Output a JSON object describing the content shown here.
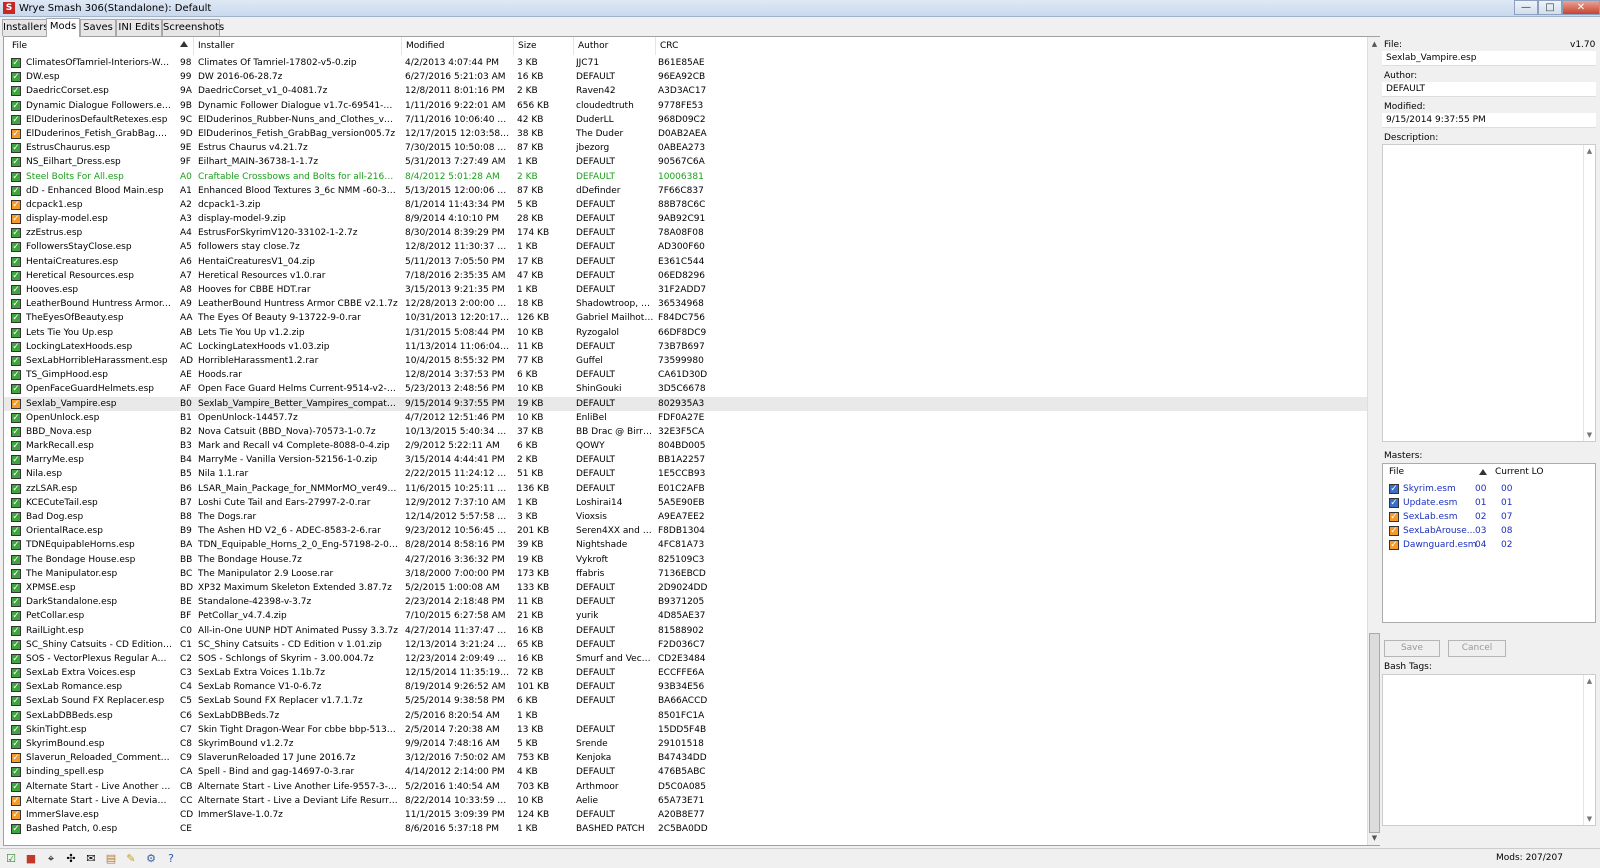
{
  "window": {
    "title": "Wrye Smash 306(Standalone): Default",
    "app_icon": "S",
    "controls": {
      "minimize": "—",
      "maximize": "□",
      "close": "✕"
    }
  },
  "tabs": [
    "Installers",
    "Mods",
    "Saves",
    "INI Edits",
    "Screenshots"
  ],
  "mods_table": {
    "columns": {
      "file": "File",
      "installer": "Installer",
      "modified": "Modified",
      "size": "Size",
      "author": "Author",
      "crc": "CRC"
    },
    "rows": [
      {
        "file": "ClimatesOfTamriel-Interiors-Warm...",
        "lo": "98",
        "installer": "Climates Of Tamriel-17802-v5-0.zip",
        "modified": "4/2/2013 4:07:44 PM",
        "size": "3 KB",
        "author": "JJC71",
        "crc": "B61E85AE",
        "check": "green"
      },
      {
        "file": "DW.esp",
        "lo": "99",
        "installer": "DW 2016-06-28.7z",
        "modified": "6/27/2016 5:21:03 AM",
        "size": "16 KB",
        "author": "DEFAULT",
        "crc": "96EA92CB",
        "check": "green"
      },
      {
        "file": "DaedricCorset.esp",
        "lo": "9A",
        "installer": "DaedricCorset_v1_0-4081.7z",
        "modified": "12/8/2011 8:01:16 PM",
        "size": "2 KB",
        "author": "Raven42",
        "crc": "A3D3AC17",
        "check": "green"
      },
      {
        "file": "Dynamic Dialogue Followers.esp",
        "lo": "9B",
        "installer": "Dynamic Follower Dialogue v1.7c-69541-1-7c.7z",
        "modified": "1/11/2016 9:22:01 AM",
        "size": "656 KB",
        "author": "cloudedtruth",
        "crc": "9778FE53",
        "check": "green"
      },
      {
        "file": "ElDuderinosDefaultRetexes.esp",
        "lo": "9C",
        "installer": "ElDuderinos_Rubber-Nuns_and_Clothes_versio...",
        "modified": "7/11/2016 10:06:40 AM",
        "size": "42 KB",
        "author": "DuderLL",
        "crc": "968D09C2",
        "check": "green"
      },
      {
        "file": "ElDuderinos_Fetish_GrabBag.esp",
        "lo": "9D",
        "installer": "ElDuderinos_Fetish_GrabBag_version005.7z",
        "modified": "12/17/2015 12:03:58 PM",
        "size": "38 KB",
        "author": "The Duder",
        "crc": "D0AB2AEA",
        "check": "orange"
      },
      {
        "file": "EstrusChaurus.esp",
        "lo": "9E",
        "installer": "Estrus Chaurus v4.21.7z",
        "modified": "7/30/2015 10:50:08 AM",
        "size": "87 KB",
        "author": "jbezorg",
        "crc": "0ABEA273",
        "check": "green"
      },
      {
        "file": "NS_Eilhart_Dress.esp",
        "lo": "9F",
        "installer": "Eilhart_MAIN-36738-1-1.7z",
        "modified": "5/31/2013 7:27:49 AM",
        "size": "1 KB",
        "author": "DEFAULT",
        "crc": "90567C6A",
        "check": "green"
      },
      {
        "file": "Steel Bolts For All.esp",
        "lo": "A0",
        "installer": "Craftable  Crossbows and Bolts for all-21659-1-...",
        "modified": "8/4/2012 5:01:28 AM",
        "size": "2 KB",
        "author": "DEFAULT",
        "crc": "10006381",
        "check": "green",
        "green": true
      },
      {
        "file": "dD - Enhanced Blood Main.esp",
        "lo": "A1",
        "installer": "Enhanced Blood Textures 3_6c NMM -60-3-6c.7z",
        "modified": "5/13/2015 12:00:06 AM",
        "size": "87 KB",
        "author": "dDefinder",
        "crc": "7F66C837",
        "check": "green"
      },
      {
        "file": "dcpack1.esp",
        "lo": "A2",
        "installer": "dcpack1-3.zip",
        "modified": "8/1/2014 11:43:34 PM",
        "size": "5 KB",
        "author": "DEFAULT",
        "crc": "88B78C6C",
        "check": "orange"
      },
      {
        "file": "display-model.esp",
        "lo": "A3",
        "installer": "display-model-9.zip",
        "modified": "8/9/2014 4:10:10 PM",
        "size": "28 KB",
        "author": "DEFAULT",
        "crc": "9AB92C91",
        "check": "orange"
      },
      {
        "file": "zzEstrus.esp",
        "lo": "A4",
        "installer": "EstrusForSkyrimV120-33102-1-2.7z",
        "modified": "8/30/2014 8:39:29 PM",
        "size": "174 KB",
        "author": "DEFAULT",
        "crc": "78A08F08",
        "check": "green"
      },
      {
        "file": "FollowersStayClose.esp",
        "lo": "A5",
        "installer": "followers stay close.7z",
        "modified": "12/8/2012 11:30:37 PM",
        "size": "1 KB",
        "author": "DEFAULT",
        "crc": "AD300F60",
        "check": "green"
      },
      {
        "file": "HentaiCreatures.esp",
        "lo": "A6",
        "installer": "HentaiCreaturesV1_04.zip",
        "modified": "5/11/2013 7:05:50 PM",
        "size": "17 KB",
        "author": "DEFAULT",
        "crc": "E361C544",
        "check": "green"
      },
      {
        "file": "Heretical Resources.esp",
        "lo": "A7",
        "installer": "Heretical Resources v1.0.rar",
        "modified": "7/18/2016 2:35:35 AM",
        "size": "47 KB",
        "author": "DEFAULT",
        "crc": "06ED8296",
        "check": "green"
      },
      {
        "file": "Hooves.esp",
        "lo": "A8",
        "installer": "Hooves for CBBE HDT.rar",
        "modified": "3/15/2013 9:21:35 PM",
        "size": "1 KB",
        "author": "DEFAULT",
        "crc": "31F2ADD7",
        "check": "green"
      },
      {
        "file": "LeatherBound Huntress Armor.esp",
        "lo": "A9",
        "installer": "LeatherBound Huntress Armor CBBE v2.1.7z",
        "modified": "12/28/2013 2:00:00 PM",
        "size": "18 KB",
        "author": "Shadowtroop, B...",
        "crc": "36534968",
        "check": "green"
      },
      {
        "file": "TheEyesOfBeauty.esp",
        "lo": "AA",
        "installer": "The Eyes Of Beauty 9-13722-9-0.rar",
        "modified": "10/31/2013 12:20:17 AM",
        "size": "126 KB",
        "author": "Gabriel Mailhot a...",
        "crc": "F84DC756",
        "check": "green"
      },
      {
        "file": "Lets Tie You Up.esp",
        "lo": "AB",
        "installer": "Lets Tie You Up v1.2.zip",
        "modified": "1/31/2015 5:08:44 PM",
        "size": "10 KB",
        "author": "Ryzogalol",
        "crc": "66DF8DC9",
        "check": "green"
      },
      {
        "file": "LockingLatexHoods.esp",
        "lo": "AC",
        "installer": "LockingLatexHoods v1.03.zip",
        "modified": "11/13/2014 11:06:04 PM",
        "size": "11 KB",
        "author": "DEFAULT",
        "crc": "73B7B697",
        "check": "green"
      },
      {
        "file": "SexLabHorribleHarassment.esp",
        "lo": "AD",
        "installer": "HorribleHarassment1.2.rar",
        "modified": "10/4/2015 8:55:32 PM",
        "size": "77 KB",
        "author": "Guffel",
        "crc": "73599980",
        "check": "green"
      },
      {
        "file": "TS_GimpHood.esp",
        "lo": "AE",
        "installer": "Hoods.rar",
        "modified": "12/8/2014 3:37:53 PM",
        "size": "6 KB",
        "author": "DEFAULT",
        "crc": "CA61D30D",
        "check": "green"
      },
      {
        "file": "OpenFaceGuardHelmets.esp",
        "lo": "AF",
        "installer": "Open Face Guard Helms Current-9514-v2-0.zip",
        "modified": "5/23/2013 2:48:56 PM",
        "size": "10 KB",
        "author": "ShinGouki",
        "crc": "3D5C6678",
        "check": "green"
      },
      {
        "file": "Sexlab_Vampire.esp",
        "lo": "B0",
        "installer": "Sexlab_Vampire_Better_Vampires_compatible_1...",
        "modified": "9/15/2014 9:37:55 PM",
        "size": "19 KB",
        "author": "DEFAULT",
        "crc": "802935A3",
        "check": "orange",
        "selected": true
      },
      {
        "file": "OpenUnlock.esp",
        "lo": "B1",
        "installer": "OpenUnlock-14457.7z",
        "modified": "4/7/2012 12:51:46 PM",
        "size": "10 KB",
        "author": "EnliBel",
        "crc": "FDF0A27E",
        "check": "green"
      },
      {
        "file": "BBD_Nova.esp",
        "lo": "B2",
        "installer": "Nova Catsuit (BBD_Nova)-70573-1-0.7z",
        "modified": "10/13/2015 5:40:34 AM",
        "size": "37 KB",
        "author": "BB Drac @ BirraB...",
        "crc": "32E3F5CA",
        "check": "green"
      },
      {
        "file": "MarkRecall.esp",
        "lo": "B3",
        "installer": "Mark and Recall v4 Complete-8088-0-4.zip",
        "modified": "2/9/2012 5:22:11 AM",
        "size": "6 KB",
        "author": "QOWY",
        "crc": "804BD005",
        "check": "green"
      },
      {
        "file": "MarryMe.esp",
        "lo": "B4",
        "installer": "MarryMe - Vanilla Version-52156-1-0.zip",
        "modified": "3/15/2014 4:44:41 PM",
        "size": "2 KB",
        "author": "DEFAULT",
        "crc": "BB1A2257",
        "check": "green"
      },
      {
        "file": "Nila.esp",
        "lo": "B5",
        "installer": "Nila 1.1.rar",
        "modified": "2/22/2015 11:24:12 PM",
        "size": "51 KB",
        "author": "DEFAULT",
        "crc": "1E5CCB93",
        "check": "green"
      },
      {
        "file": "zzLSAR.esp",
        "lo": "B6",
        "installer": "LSAR_Main_Package_for_NMMorMO_ver499-55...",
        "modified": "11/6/2015 10:25:11 PM",
        "size": "136 KB",
        "author": "DEFAULT",
        "crc": "E01C2AFB",
        "check": "green"
      },
      {
        "file": "KCECuteTail.esp",
        "lo": "B7",
        "installer": "Loshi Cute Tail and Ears-27997-2-0.rar",
        "modified": "12/9/2012 7:37:10 AM",
        "size": "1 KB",
        "author": "Loshirai14",
        "crc": "5A5E90EB",
        "check": "green"
      },
      {
        "file": "Bad Dog.esp",
        "lo": "B8",
        "installer": "The Dogs.rar",
        "modified": "12/14/2012 5:57:58 PM",
        "size": "3 KB",
        "author": "Vioxsis",
        "crc": "A9EA7EE2",
        "check": "green"
      },
      {
        "file": "OrientalRace.esp",
        "lo": "B9",
        "installer": "The Ashen HD V2_6 - ADEC-8583-2-6.rar",
        "modified": "9/23/2012 10:56:45 PM",
        "size": "201 KB",
        "author": "Seren4XX and R...",
        "crc": "F8DB1304",
        "check": "green"
      },
      {
        "file": "TDNEquipableHorns.esp",
        "lo": "BA",
        "installer": "TDN_Equipable_Horns_2_0_Eng-57198-2-0.rar",
        "modified": "8/28/2014 8:58:16 PM",
        "size": "39 KB",
        "author": "Nightshade",
        "crc": "4FC81A73",
        "check": "green"
      },
      {
        "file": "The Bondage House.esp",
        "lo": "BB",
        "installer": "The Bondage House.7z",
        "modified": "4/27/2016 3:36:32 PM",
        "size": "19 KB",
        "author": "Vykroft",
        "crc": "825109C3",
        "check": "green"
      },
      {
        "file": "The Manipulator.esp",
        "lo": "BC",
        "installer": "The Manipulator 2.9 Loose.rar",
        "modified": "3/18/2000 7:00:00 PM",
        "size": "173 KB",
        "author": "ffabris",
        "crc": "7136EBCD",
        "check": "green"
      },
      {
        "file": "XPMSE.esp",
        "lo": "BD",
        "installer": "XP32 Maximum Skeleton Extended 3.87.7z",
        "modified": "5/2/2015 1:00:08 AM",
        "size": "133 KB",
        "author": "DEFAULT",
        "crc": "2D9024DD",
        "check": "green"
      },
      {
        "file": "DarkStandalone.esp",
        "lo": "BE",
        "installer": "Standalone-42398-v-3.7z",
        "modified": "2/23/2014 2:18:48 PM",
        "size": "11 KB",
        "author": "DEFAULT",
        "crc": "B9371205",
        "check": "green"
      },
      {
        "file": "PetCollar.esp",
        "lo": "BF",
        "installer": "PetCollar_v4.7.4.zip",
        "modified": "7/10/2015 6:27:58 AM",
        "size": "21 KB",
        "author": "yurik",
        "crc": "4D85AE37",
        "check": "green"
      },
      {
        "file": "RailLight.esp",
        "lo": "C0",
        "installer": "All-in-One UUNP HDT Animated Pussy 3.3.7z",
        "modified": "4/27/2014 11:37:47 AM",
        "size": "16 KB",
        "author": "DEFAULT",
        "crc": "81588902",
        "check": "green"
      },
      {
        "file": "SC_Shiny Catsuits - CD Edition.esp",
        "lo": "C1",
        "installer": "SC_Shiny Catsuits - CD Edition v 1.01.zip",
        "modified": "12/13/2014 3:21:24 PM",
        "size": "65 KB",
        "author": "DEFAULT",
        "crc": "F2D036C7",
        "check": "green"
      },
      {
        "file": "SOS - VectorPlexus Regular Addon...",
        "lo": "C2",
        "installer": "SOS - Schlongs of Skyrim - 3.00.004.7z",
        "modified": "12/23/2014 2:09:49 PM",
        "size": "16 KB",
        "author": "Smurf and Vecto...",
        "crc": "CD2E3484",
        "check": "green"
      },
      {
        "file": "SexLab Extra Voices.esp",
        "lo": "C3",
        "installer": "SexLab Extra Voices 1.1b.7z",
        "modified": "12/15/2014 11:35:19 AM",
        "size": "72 KB",
        "author": "DEFAULT",
        "crc": "ECCFFE6A",
        "check": "green"
      },
      {
        "file": "SexLab Romance.esp",
        "lo": "C4",
        "installer": "SexLab Romance V1-0-6.7z",
        "modified": "8/19/2014 9:26:52 AM",
        "size": "101 KB",
        "author": "DEFAULT",
        "crc": "93B34E56",
        "check": "green"
      },
      {
        "file": "SexLab Sound FX Replacer.esp",
        "lo": "C5",
        "installer": "SexLab Sound FX Replacer v1.7.1.7z",
        "modified": "5/25/2014 9:38:58 PM",
        "size": "6 KB",
        "author": "DEFAULT",
        "crc": "BA66ACCD",
        "check": "green"
      },
      {
        "file": "SexLabDBBeds.esp",
        "lo": "C6",
        "installer": "SexLabDBBeds.7z",
        "modified": "2/5/2016 8:20:54 AM",
        "size": "1 KB",
        "author": "",
        "crc": "8501FC1A",
        "check": "green"
      },
      {
        "file": "SkinTight.esp",
        "lo": "C7",
        "installer": "Skin Tight Dragon-Wear For cbbe bbp-51323-1-...",
        "modified": "2/5/2014 7:20:38 AM",
        "size": "13 KB",
        "author": "DEFAULT",
        "crc": "15DD5F4B",
        "check": "green"
      },
      {
        "file": "SkyrimBound.esp",
        "lo": "C8",
        "installer": "SkyrimBound v1.2.7z",
        "modified": "9/9/2014 7:48:16 AM",
        "size": "5 KB",
        "author": "Srende",
        "crc": "29101518",
        "check": "green"
      },
      {
        "file": "Slaverun_Reloaded_Comments.esp",
        "lo": "C9",
        "installer": "SlaverunReloaded 17 June 2016.7z",
        "modified": "3/12/2016 7:50:02 AM",
        "size": "753 KB",
        "author": "Kenjoka",
        "crc": "B47434DD",
        "check": "orange"
      },
      {
        "file": "binding_spell.esp",
        "lo": "CA",
        "installer": "Spell - Bind and gag-14697-0-3.rar",
        "modified": "4/14/2012 2:14:00 PM",
        "size": "4 KB",
        "author": "DEFAULT",
        "crc": "476B5ABC",
        "check": "green"
      },
      {
        "file": "Alternate Start - Live Another Life...",
        "lo": "CB",
        "installer": "Alternate Start - Live Another Life-9557-3-1-4.7z",
        "modified": "5/2/2016 1:40:54 AM",
        "size": "703 KB",
        "author": "Arthmoor",
        "crc": "D5C0A085",
        "check": "green"
      },
      {
        "file": "Alternate Start - Live A Deviant Lif...",
        "lo": "CC",
        "installer": "Alternate Start - Live a Deviant Life Resurrectio...",
        "modified": "8/22/2014 10:33:59 PM",
        "size": "10 KB",
        "author": "Aelie",
        "crc": "65A73E71",
        "check": "orange"
      },
      {
        "file": "ImmerSlave.esp",
        "lo": "CD",
        "installer": "ImmerSlave-1.0.7z",
        "modified": "11/1/2015 3:09:39 PM",
        "size": "124 KB",
        "author": "DEFAULT",
        "crc": "A20B8E77",
        "check": "orange"
      },
      {
        "file": "Bashed Patch, 0.esp",
        "lo": "CE",
        "installer": "",
        "modified": "8/6/2016 5:37:18 PM",
        "size": "1 KB",
        "author": "BASHED PATCH",
        "crc": "2C5BA0DD",
        "check": "green"
      }
    ]
  },
  "details": {
    "file_label": "File:",
    "version": "v1.70",
    "file": "Sexlab_Vampire.esp",
    "author_label": "Author:",
    "author": "DEFAULT",
    "modified_label": "Modified:",
    "modified": "9/15/2014 9:37:55 PM",
    "description_label": "Description:",
    "masters_label": "Masters:",
    "masters_columns": {
      "file": "File",
      "current_lo": "Current LO"
    },
    "masters": [
      {
        "file": "Skyrim.esm",
        "lo": "00",
        "current": "00",
        "check": "blue"
      },
      {
        "file": "Update.esm",
        "lo": "01",
        "current": "01",
        "check": "blue"
      },
      {
        "file": "SexLab.esm",
        "lo": "02",
        "current": "07",
        "check": "orange"
      },
      {
        "file": "SexLabArouse...",
        "lo": "03",
        "current": "08",
        "check": "orange"
      },
      {
        "file": "Dawnguard.esm",
        "lo": "04",
        "current": "02",
        "check": "orange"
      }
    ],
    "save_label": "Save",
    "cancel_label": "Cancel",
    "bash_tags_label": "Bash Tags:"
  },
  "toolbar_icons": [
    "check-all-icon",
    "stop-icon",
    "mouse-icon",
    "arrows-icon",
    "mail-icon",
    "doc-icon",
    "edit-icon",
    "settings-icon",
    "help-icon"
  ],
  "status": {
    "mods_count": "Mods: 207/207"
  }
}
